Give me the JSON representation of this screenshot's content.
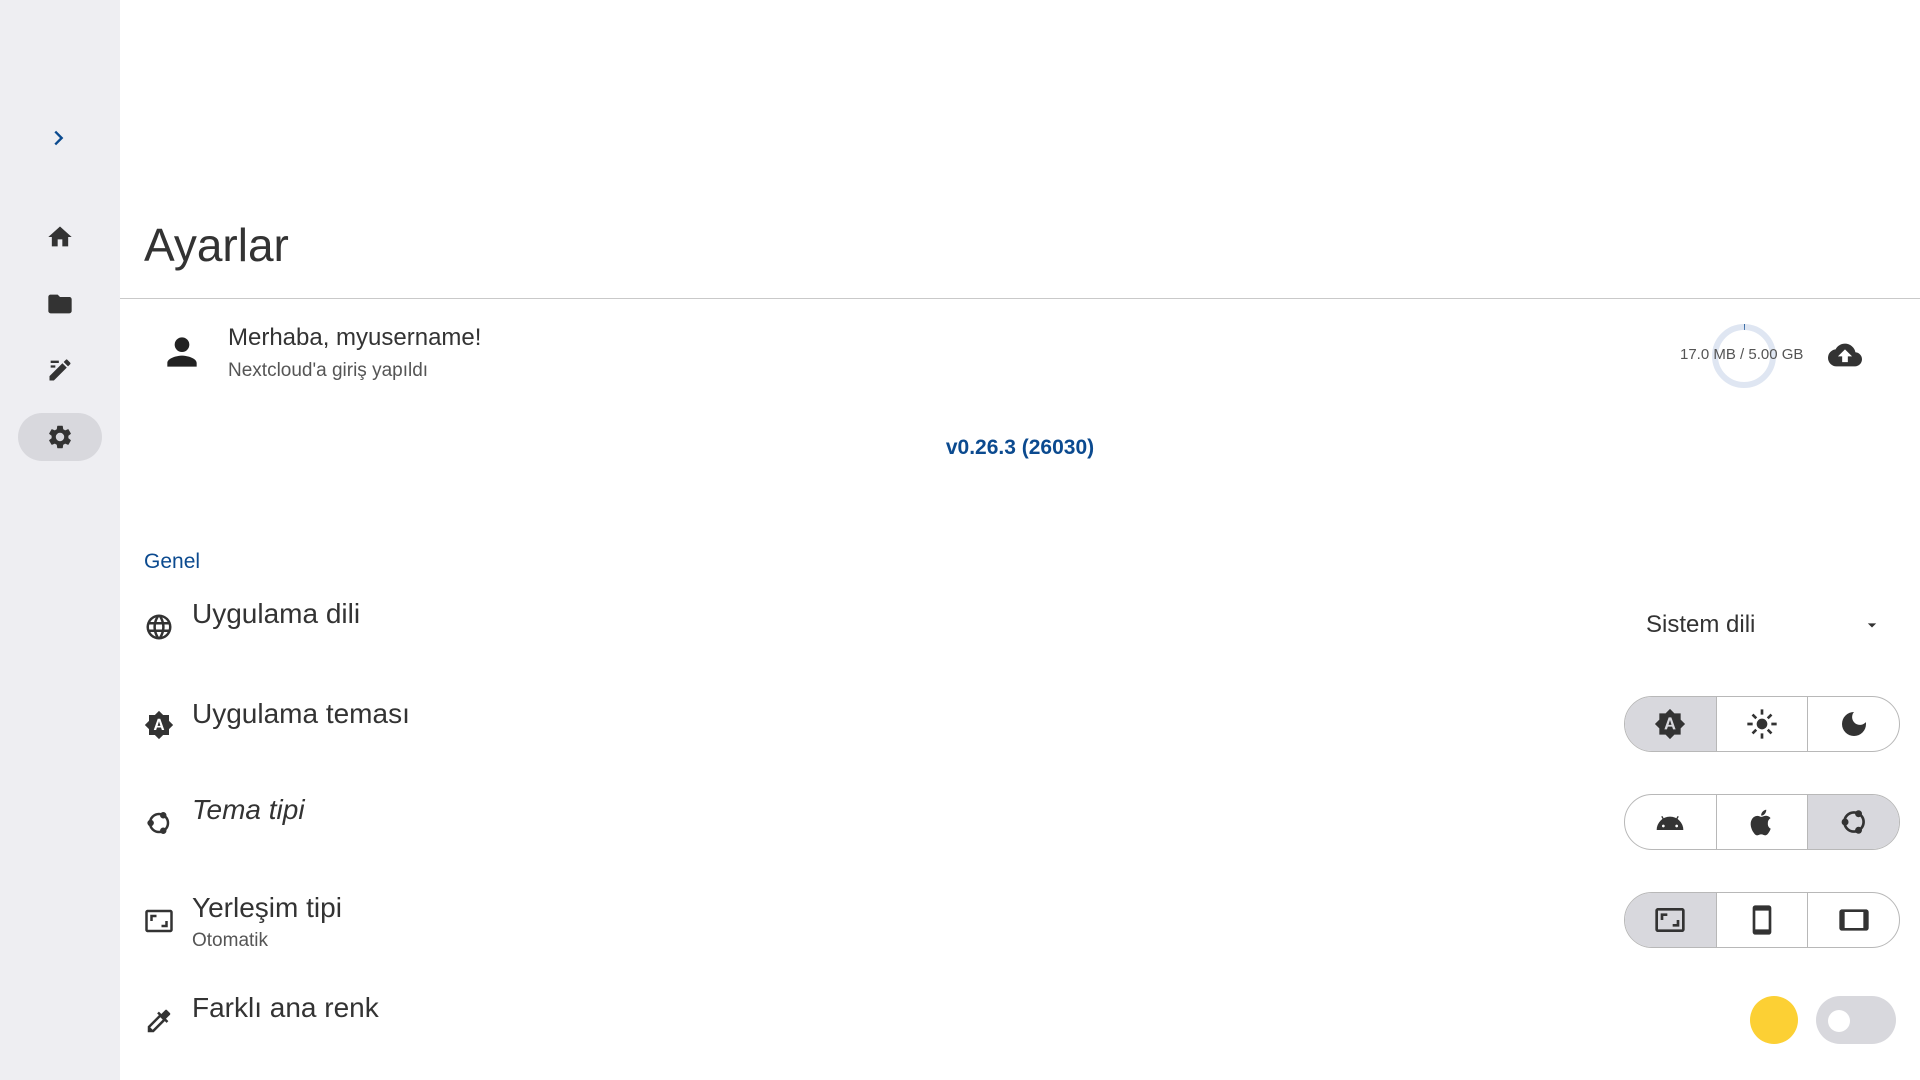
{
  "page": {
    "title": "Ayarlar",
    "accent_color": "#0b4a8f"
  },
  "nav_rail": {
    "expand_icon": "chevron-right-icon",
    "items": [
      {
        "id": "home",
        "icon": "home-icon",
        "active": false
      },
      {
        "id": "files",
        "icon": "folder-icon",
        "active": false
      },
      {
        "id": "editor",
        "icon": "edit-icon",
        "active": false
      },
      {
        "id": "settings",
        "icon": "gear-icon",
        "active": true
      }
    ]
  },
  "account": {
    "greeting": "Merhaba, myusername!",
    "status": "Nextcloud'a giriş yapıldı",
    "storage_text": "17.0 MB / 5.00 GB",
    "storage_used_fraction": 0.0034,
    "upload_icon": "cloud-upload-icon"
  },
  "version": "v0.26.3 (26030)",
  "sections": {
    "general": {
      "label": "Genel",
      "language": {
        "title": "Uygulama dili",
        "icon": "globe-icon",
        "selected": "Sistem dili"
      },
      "theme": {
        "title": "Uygulama teması",
        "icon": "brightness-auto-icon",
        "options": [
          "brightness-auto-icon",
          "sun-icon",
          "moon-icon"
        ],
        "selected_index": 0
      },
      "theme_type": {
        "title": "Tema tipi",
        "icon": "ubuntu-icon",
        "options": [
          "android-icon",
          "apple-icon",
          "ubuntu-icon"
        ],
        "selected_index": 2
      },
      "layout": {
        "title": "Yerleşim tipi",
        "subtitle": "Otomatik",
        "icon": "aspect-ratio-icon",
        "options": [
          "aspect-ratio-icon",
          "phone-portrait-icon",
          "tablet-landscape-icon"
        ],
        "selected_index": 0
      },
      "accent": {
        "title": "Farklı ana renk",
        "icon": "eyedropper-icon",
        "color": "#fcd034",
        "enabled": false
      }
    }
  }
}
